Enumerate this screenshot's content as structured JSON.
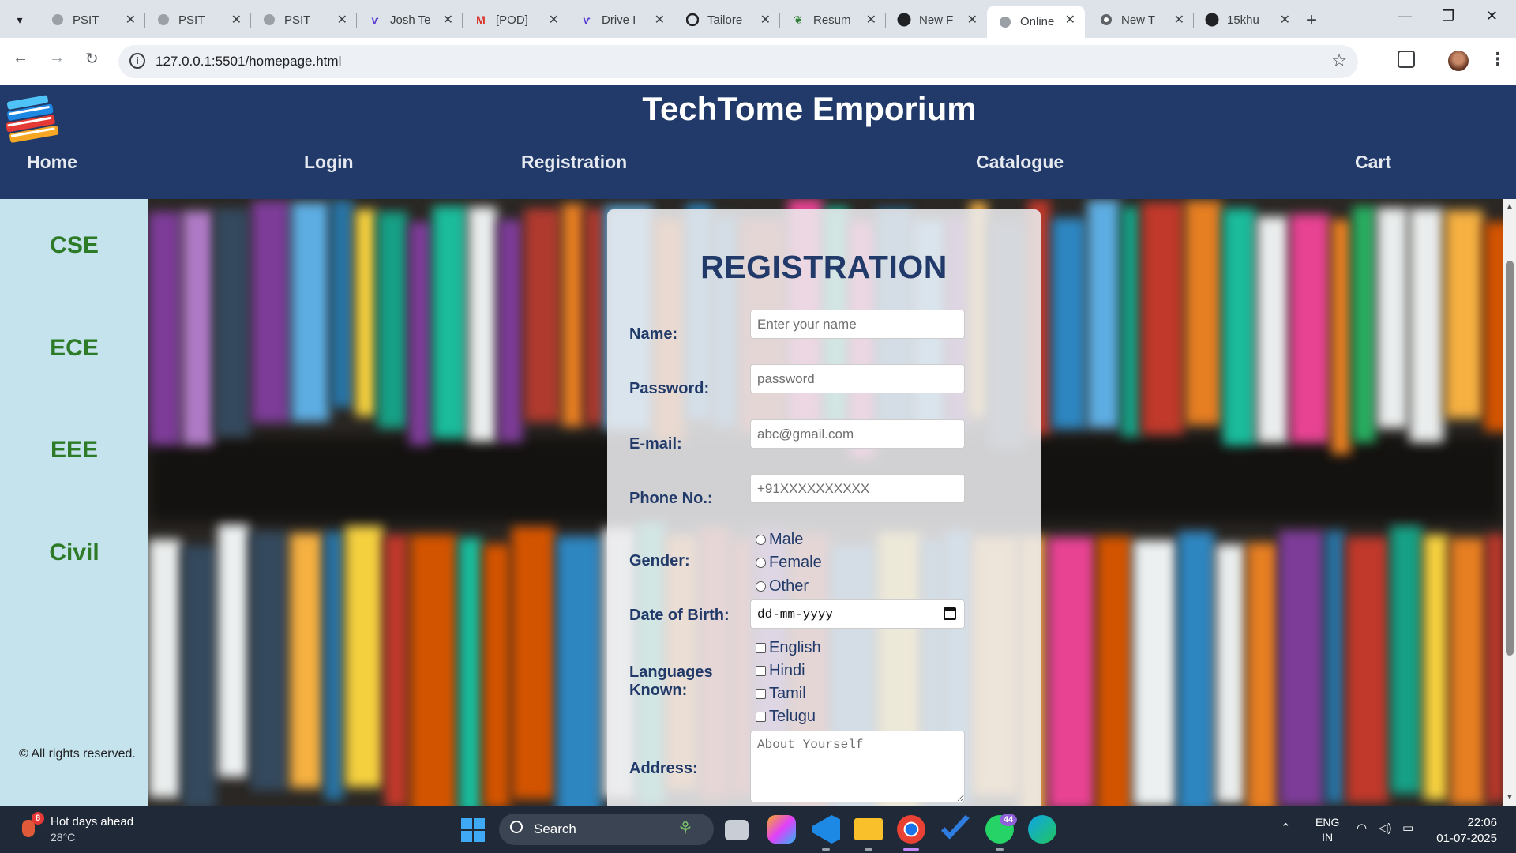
{
  "browser": {
    "tabs": [
      {
        "title": "PSIT",
        "icon": "globe-icon"
      },
      {
        "title": "PSIT",
        "icon": "globe-icon"
      },
      {
        "title": "PSIT",
        "icon": "globe-icon"
      },
      {
        "title": "Josh Te",
        "icon": "wing-icon"
      },
      {
        "title": "[POD]",
        "icon": "gmail-icon"
      },
      {
        "title": "Drive I",
        "icon": "wing-icon"
      },
      {
        "title": "Tailore",
        "icon": "openai-icon"
      },
      {
        "title": "Resum",
        "icon": "leaf-icon"
      },
      {
        "title": "New F",
        "icon": "github-icon"
      },
      {
        "title": "Online",
        "icon": "globe-icon",
        "active": true
      },
      {
        "title": "New T",
        "icon": "chrome-icon"
      },
      {
        "title": "15khu",
        "icon": "github-icon"
      }
    ],
    "url": "127.0.0.1:5501/homepage.html"
  },
  "site": {
    "title": "TechTome Emporium",
    "nav": [
      "Home",
      "Login",
      "Registration",
      "Catalogue",
      "Cart"
    ],
    "departments": [
      "CSE",
      "ECE",
      "EEE",
      "Civil"
    ],
    "copyright": "© All rights reserved.",
    "colors": {
      "header": "#213a69",
      "sidebar": "#c5e3ec",
      "dept_text": "#2d7a27"
    }
  },
  "form": {
    "title": "REGISTRATION",
    "name": {
      "label": "Name:",
      "placeholder": "Enter your name"
    },
    "password": {
      "label": "Password:",
      "placeholder": "password"
    },
    "email": {
      "label": "E-mail:",
      "placeholder": "abc@gmail.com"
    },
    "phone": {
      "label": "Phone No.:",
      "placeholder": "+91XXXXXXXXXX"
    },
    "gender": {
      "label": "Gender:",
      "options": [
        "Male",
        "Female",
        "Other"
      ]
    },
    "dob": {
      "label": "Date of Birth:",
      "value": "dd-mm-yyyy"
    },
    "languages": {
      "label": "Languages Known:",
      "options": [
        "English",
        "Hindi",
        "Tamil",
        "Telugu"
      ]
    },
    "address": {
      "label": "Address:",
      "placeholder": "About Yourself"
    }
  },
  "taskbar": {
    "weather_title": "Hot days ahead",
    "weather_temp": "28°C",
    "weather_badge": "8",
    "search_label": "Search",
    "whatsapp_badge": "44",
    "lang_line1": "ENG",
    "lang_line2": "IN",
    "time": "22:06",
    "date": "01-07-2025"
  }
}
